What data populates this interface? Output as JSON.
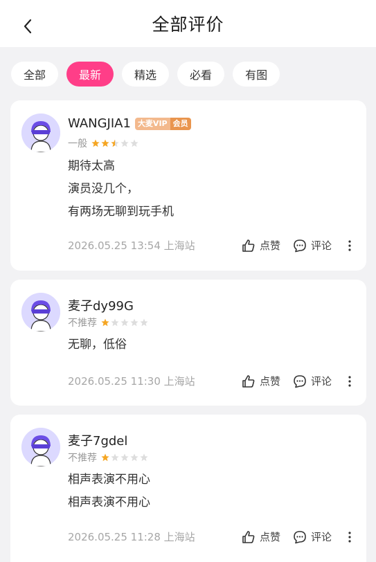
{
  "header": {
    "title": "全部评价"
  },
  "tabs": [
    {
      "label": "全部"
    },
    {
      "label": "最新"
    },
    {
      "label": "精选"
    },
    {
      "label": "必看"
    },
    {
      "label": "有图"
    }
  ],
  "active_tab": "最新",
  "reviews": [
    {
      "username": "WANGJIA1",
      "badge": {
        "vip": "大麦VIP",
        "member": "会员"
      },
      "rating_text": "一般",
      "rating": 2.5,
      "lines": [
        "期待太高",
        "演员没几个，",
        "有两场无聊到玩手机"
      ],
      "meta": "2026.05.25 13:54 上海站",
      "like_label": "点赞",
      "comment_label": "评论"
    },
    {
      "username": "麦子dy99G",
      "rating_text": "不推荐",
      "rating": 1,
      "lines": [
        "无聊，低俗"
      ],
      "meta": "2026.05.25 11:30 上海站",
      "like_label": "点赞",
      "comment_label": "评论"
    },
    {
      "username": "麦子7gdel",
      "rating_text": "不推荐",
      "rating": 1,
      "lines": [
        "相声表演不用心",
        "相声表演不用心"
      ],
      "meta": "2026.05.25 11:28 上海站",
      "like_label": "点赞",
      "comment_label": "评论"
    }
  ],
  "colors": {
    "accent": "#ff3e88",
    "star": "#f5a623",
    "star_empty": "#dddddd"
  }
}
